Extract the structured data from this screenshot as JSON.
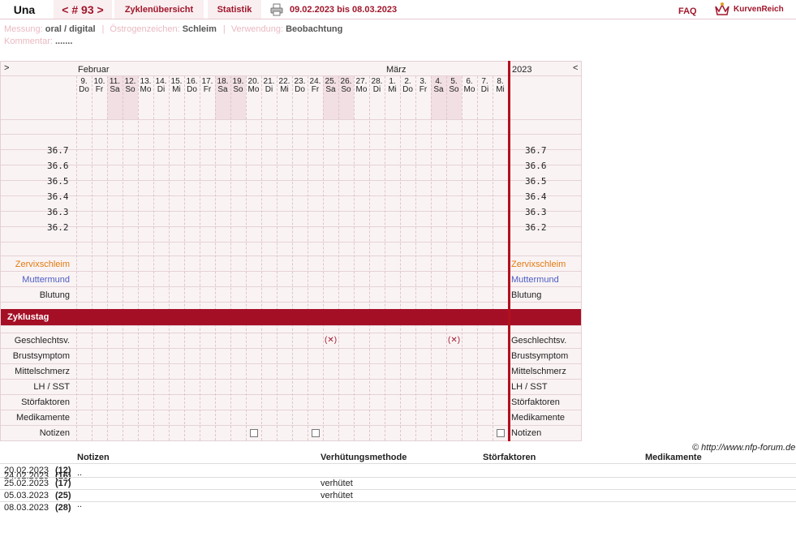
{
  "header": {
    "name": "Una",
    "nav": "< # 93 >",
    "tab_overview": "Zyklenübersicht",
    "tab_stats": "Statistik",
    "date_range": "09.02.2023 bis 08.03.2023",
    "faq": "FAQ",
    "logo": "KurvenReich"
  },
  "meta": {
    "messung_k": "Messung:",
    "messung_v": "oral / digital",
    "oestrogen_k": "Östrogenzeichen:",
    "oestrogen_v": "Schleim",
    "verwendung_k": "Verwendung:",
    "verwendung_v": "Beobachtung",
    "kommentar_k": "Kommentar:",
    "kommentar_v": "......."
  },
  "chart": {
    "prev": ">",
    "next": "<",
    "month1": "Februar",
    "month2": "März",
    "year": "2023",
    "days": [
      [
        "9.",
        "Do"
      ],
      [
        "10.",
        "Fr"
      ],
      [
        "11.",
        "Sa"
      ],
      [
        "12.",
        "So"
      ],
      [
        "13.",
        "Mo"
      ],
      [
        "14.",
        "Di"
      ],
      [
        "15.",
        "Mi"
      ],
      [
        "16.",
        "Do"
      ],
      [
        "17.",
        "Fr"
      ],
      [
        "18.",
        "Sa"
      ],
      [
        "19.",
        "So"
      ],
      [
        "20.",
        "Mo"
      ],
      [
        "21.",
        "Di"
      ],
      [
        "22.",
        "Mi"
      ],
      [
        "23.",
        "Do"
      ],
      [
        "24.",
        "Fr"
      ],
      [
        "25.",
        "Sa"
      ],
      [
        "26.",
        "So"
      ],
      [
        "27.",
        "Mo"
      ],
      [
        "28.",
        "Di"
      ],
      [
        "1.",
        "Mi"
      ],
      [
        "2.",
        "Do"
      ],
      [
        "3.",
        "Fr"
      ],
      [
        "4.",
        "Sa"
      ],
      [
        "5.",
        "So"
      ],
      [
        "6.",
        "Mo"
      ],
      [
        "7.",
        "Di"
      ],
      [
        "8.",
        "Mi"
      ]
    ],
    "temps": [
      "36.7",
      "36.6",
      "36.5",
      "36.4",
      "36.3",
      "36.2"
    ],
    "zervix": "Zervixschleim",
    "muttermund": "Muttermund",
    "blutung": "Blutung",
    "zyklustag": "Zyklustag",
    "rows": [
      "Geschlechtsv.",
      "Brustsymptom",
      "Mittelschmerz",
      "LH / SST",
      "Störfaktoren",
      "Medikamente",
      "Notizen"
    ],
    "gv_mark": "(✕)"
  },
  "copyright": "© http://www.nfp-forum.de",
  "notes": {
    "h_notizen": "Notizen",
    "h_verh": "Verhütungsmethode",
    "h_stoer": "Störfaktoren",
    "h_med": "Medikamente",
    "rows": [
      {
        "date": "20.02.2023",
        "day": "(12)",
        "note": "",
        "verh": ""
      },
      {
        "date": "24.02.2023",
        "day": "(16)",
        "note": "..",
        "verh": ""
      },
      {
        "date": "25.02.2023",
        "day": "(17)",
        "note": "",
        "verh": "verhütet"
      },
      {
        "date": "05.03.2023",
        "day": "(25)",
        "note": "",
        "verh": "verhütet"
      },
      {
        "date": "08.03.2023",
        "day": "(28)",
        "note": "..",
        "verh": ""
      }
    ]
  }
}
